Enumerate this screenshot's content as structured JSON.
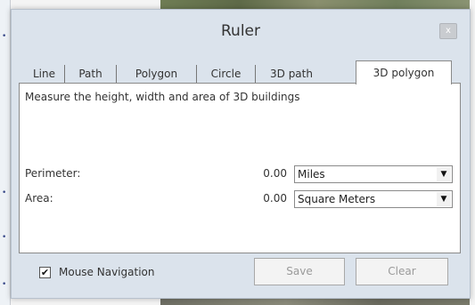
{
  "window": {
    "title": "Ruler",
    "close_glyph": "x"
  },
  "tabs": [
    {
      "label": "Line",
      "active": false
    },
    {
      "label": "Path",
      "active": false
    },
    {
      "label": "Polygon",
      "active": false
    },
    {
      "label": "Circle",
      "active": false
    },
    {
      "label": "3D path",
      "active": false
    },
    {
      "label": "3D polygon",
      "active": true
    }
  ],
  "panel": {
    "description": "Measure the height, width and area of 3D buildings",
    "perimeter": {
      "label": "Perimeter:",
      "value": "0.00",
      "unit": "Miles"
    },
    "area": {
      "label": "Area:",
      "value": "0.00",
      "unit": "Square Meters"
    }
  },
  "footer": {
    "mouse_navigation_label": "Mouse Navigation",
    "mouse_navigation_checked": true,
    "checkmark": "✔",
    "save_label": "Save",
    "clear_label": "Clear"
  },
  "icons": {
    "dropdown_arrow": "▼"
  },
  "colors": {
    "window_bg": "#dbe3ec",
    "panel_bg": "#ffffff",
    "disabled_text": "#9a9a9a"
  }
}
